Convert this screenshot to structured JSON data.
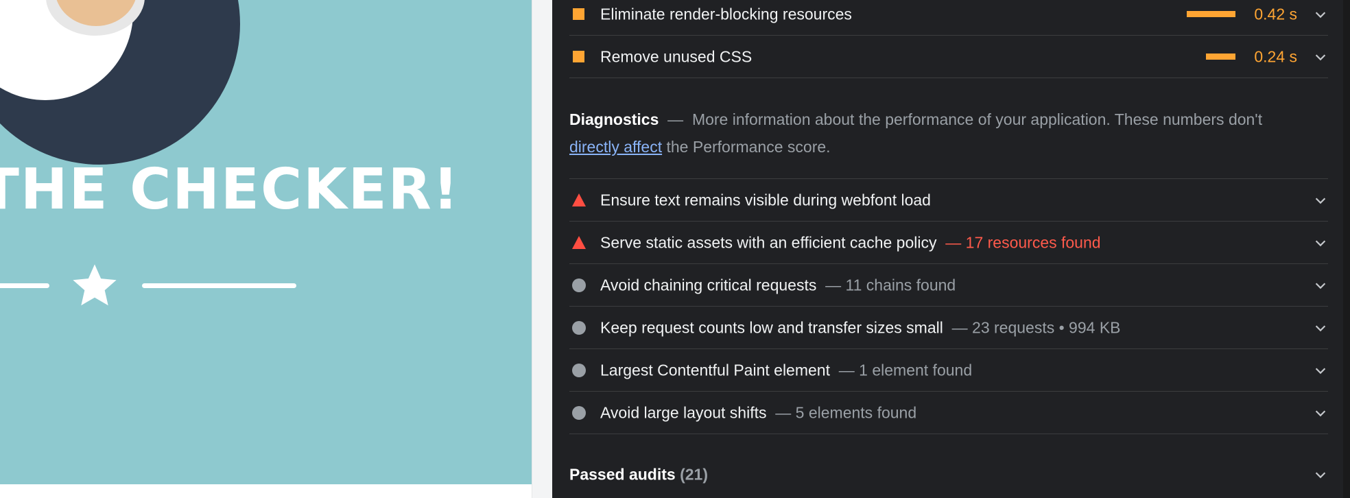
{
  "preview": {
    "headline": "THE CHECKER!",
    "colors": {
      "background": "#8ec9cf",
      "avatar_bg": "#2e3a4c",
      "skin": "#e9c094"
    },
    "icons": [
      "star-icon"
    ]
  },
  "opportunities": [
    {
      "label": "Eliminate render-blocking resources",
      "savings": "0.42 s",
      "icon": "square-icon",
      "savings_fraction": 1.0
    },
    {
      "label": "Remove unused CSS",
      "savings": "0.24 s",
      "icon": "square-icon",
      "savings_fraction": 0.57
    }
  ],
  "diagnostics": {
    "title": "Diagnostics",
    "dash": "—",
    "text_before": "More information about the performance of your application. These numbers don't ",
    "link": "directly affect",
    "text_after": " the Performance score.",
    "items": [
      {
        "label": "Ensure text remains visible during webfont load",
        "detail": "",
        "severity": "fail"
      },
      {
        "label": "Serve static assets with an efficient cache policy",
        "detail": "— 17 resources found",
        "severity": "fail"
      },
      {
        "label": "Avoid chaining critical requests",
        "detail": "— 11 chains found",
        "severity": "info"
      },
      {
        "label": "Keep request counts low and transfer sizes small",
        "detail": "— 23 requests • 994 KB",
        "severity": "info"
      },
      {
        "label": "Largest Contentful Paint element",
        "detail": "— 1 element found",
        "severity": "info"
      },
      {
        "label": "Avoid large layout shifts",
        "detail": "— 5 elements found",
        "severity": "info"
      }
    ]
  },
  "passed_audits": {
    "label": "Passed audits",
    "count": "(21)"
  },
  "colors": {
    "panel_bg": "#202124",
    "average": "#ffa533",
    "fail": "#ff4e42",
    "info": "#9aa0a6",
    "link": "#8ab4f8"
  }
}
